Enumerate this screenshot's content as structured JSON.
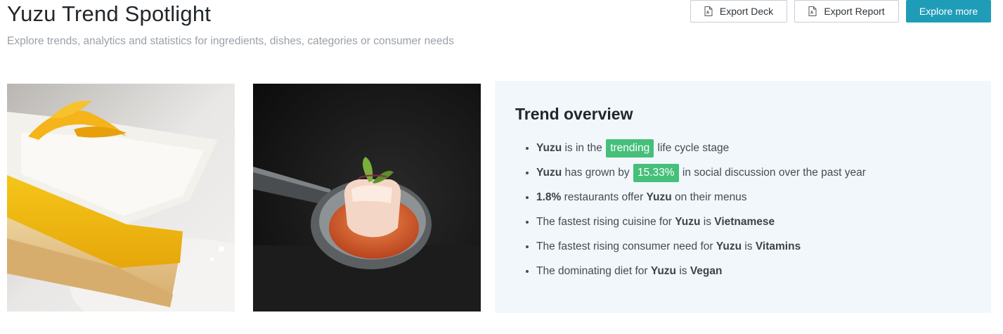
{
  "header": {
    "title": "Yuzu Trend Spotlight",
    "subtitle": "Explore trends, analytics and statistics for ingredients, dishes, categories or consumer needs"
  },
  "toolbar": {
    "export_deck_label": "Export Deck",
    "export_report_label": "Export Report",
    "explore_more_label": "Explore more",
    "export_icon": "document-icon",
    "accent_color": "#1f9db8"
  },
  "overview": {
    "title": "Trend overview",
    "highlight_color": "#45bf7a",
    "facts": [
      {
        "parts": [
          {
            "text": "Yuzu",
            "style": "bold"
          },
          {
            "text": " is in the "
          },
          {
            "text": "trending",
            "style": "pill"
          },
          {
            "text": " life cycle stage"
          }
        ]
      },
      {
        "parts": [
          {
            "text": "Yuzu",
            "style": "bold"
          },
          {
            "text": " has grown by "
          },
          {
            "text": "15.33%",
            "style": "pill"
          },
          {
            "text": " in social discussion over the past year"
          }
        ]
      },
      {
        "parts": [
          {
            "text": "1.8%",
            "style": "bold"
          },
          {
            "text": " restaurants offer "
          },
          {
            "text": "Yuzu",
            "style": "bold"
          },
          {
            "text": " on their menus"
          }
        ]
      },
      {
        "parts": [
          {
            "text": "The fastest rising cuisine for "
          },
          {
            "text": "Yuzu",
            "style": "bold"
          },
          {
            "text": " is "
          },
          {
            "text": "Vietnamese",
            "style": "bold"
          }
        ]
      },
      {
        "parts": [
          {
            "text": "The fastest rising consumer need for "
          },
          {
            "text": "Yuzu",
            "style": "bold"
          },
          {
            "text": " is "
          },
          {
            "text": "Vitamins",
            "style": "bold"
          }
        ]
      },
      {
        "parts": [
          {
            "text": "The dominating diet for "
          },
          {
            "text": "Yuzu",
            "style": "bold"
          },
          {
            "text": " is "
          },
          {
            "text": "Vegan",
            "style": "bold"
          }
        ]
      }
    ]
  }
}
